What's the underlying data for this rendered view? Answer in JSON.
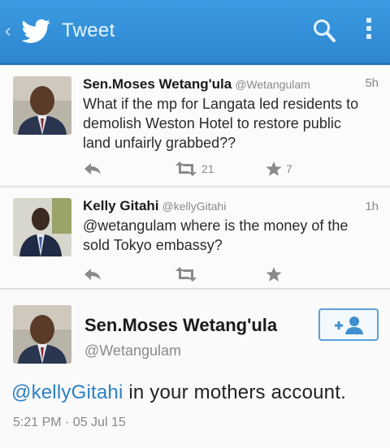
{
  "appbar": {
    "title": "Tweet",
    "back_icon": "back-chevron-icon",
    "logo_icon": "twitter-bird-icon",
    "search_icon": "search-icon",
    "overflow_icon": "overflow-menu-icon",
    "background": "#3a9be3"
  },
  "timeline": [
    {
      "name": "Sen.Moses Wetang'ula",
      "handle": "@Wetangulam",
      "time": "5h",
      "text": "What if the mp for Langata led residents to demolish Weston Hotel to restore public land unfairly grabbed??",
      "retweets": "21",
      "favorites": "7"
    },
    {
      "name": "Kelly Gitahi",
      "handle": "@kellyGitahi",
      "time": "1h",
      "text": "@wetangulam where is the money of the sold Tokyo embassy?",
      "retweets": "",
      "favorites": ""
    }
  ],
  "detail": {
    "name": "Sen.Moses Wetang'ula",
    "handle": "@Wetangulam",
    "mention": "@kellyGitahi",
    "text": " in your mothers account.",
    "timestamp": "5:21 PM · 05 Jul 15",
    "follow_icon": "add-user-icon"
  },
  "colors": {
    "link": "#2b7fc4",
    "muted": "#8a8a8a",
    "accent": "#5aa0d8"
  }
}
